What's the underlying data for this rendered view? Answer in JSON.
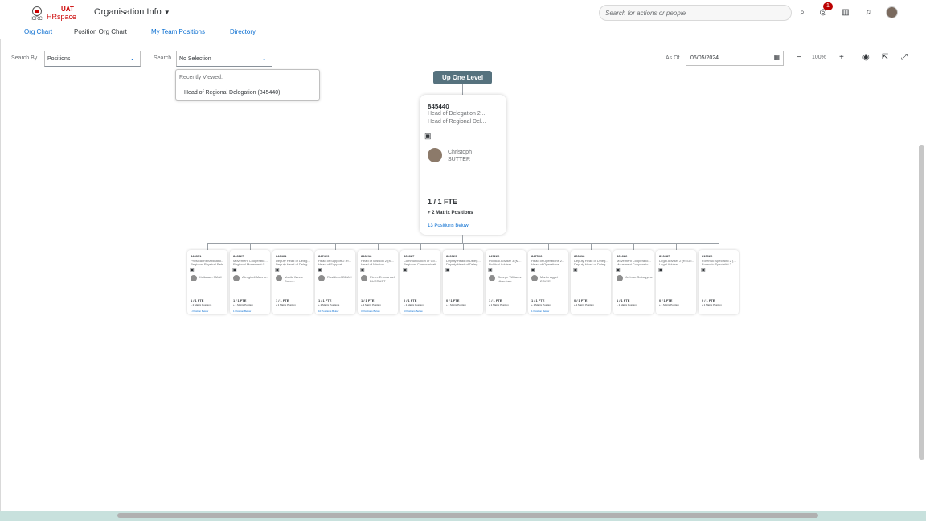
{
  "header": {
    "logo_uat": "UAT",
    "logo_org": "ICRC",
    "logo_product": "HRspace",
    "app_title": "Organisation Info",
    "search_placeholder": "Search for actions or people",
    "notification_count": "1"
  },
  "tabs": [
    {
      "label": "Org Chart"
    },
    {
      "label": "Position Org Chart"
    },
    {
      "label": "My Team Positions"
    },
    {
      "label": "Directory"
    }
  ],
  "toolbar": {
    "search_by_label": "Search By",
    "search_by_value": "Positions",
    "search_label": "Search",
    "search_value": "No Selection",
    "as_of_label": "As Of",
    "as_of_value": "06/05/2024",
    "zoom_level": "100%"
  },
  "dropdown": {
    "header": "Recently Viewed:",
    "item": "Head of Regional Delegation (845440)"
  },
  "chart": {
    "up_one_level": "Up One Level",
    "main": {
      "id": "845440",
      "title1": "Head of Delegation 2 ...",
      "title2": "Head of Regional Del...",
      "name_first": "Christoph",
      "name_last": "SUTTER",
      "fte": "1 / 1 FTE",
      "matrix": "+ 2 Matrix Positions",
      "below": "13 Positions Below"
    },
    "children": [
      {
        "id": "846371",
        "t1": "Physical Rehabilitatio...",
        "t2": "Regional Physical Reh...",
        "name": "Kailasam MANI",
        "fte": "1 / 1 FTE",
        "matrix": "+ 2 Matrix Positions",
        "below": "1 Position Below"
      },
      {
        "id": "846127",
        "t1": "Movement Cooperatio...",
        "t2": "Regional Movement C...",
        "name": "Alengindi Mannu...",
        "fte": "1 / 1 FTE",
        "matrix": "+ 1 Matrix Position",
        "below": "1 Position Below"
      },
      {
        "id": "846461",
        "t1": "Deputy Head of Deleg...",
        "t2": "Deputy Head of Deleg...",
        "name": "Vanile Weele Dono...",
        "fte": "1 / 1 FTE",
        "matrix": "+ 1 Matrix Position",
        "below": ""
      },
      {
        "id": "847429",
        "t1": "Head of Support 2 (R...",
        "t2": "Head of Support",
        "name": "Rusidina ADDAH",
        "fte": "1 / 1 FTE",
        "matrix": "+ 2 Matrix Positions",
        "below": "10 Positions Below"
      },
      {
        "id": "846218",
        "t1": "Head of Mission 2 (M...",
        "t2": "Head of Mission",
        "name": "Pierre Emmanuel DUCRUET",
        "fte": "1 / 1 FTE",
        "matrix": "+ 1 Matrix Position",
        "below": "3 Positions Below"
      },
      {
        "id": "860627",
        "t1": "Communication or Co...",
        "t2": "Regional Communicati...",
        "name": "",
        "fte": "0 / 1 FTE",
        "matrix": "+ 1 Matrix Position",
        "below": "4 Positions Below"
      },
      {
        "id": "860029",
        "t1": "Deputy Head of Deleg...",
        "t2": "Deputy Head of Deleg...",
        "name": "",
        "fte": "0 / 1 FTE",
        "matrix": "+ 1 Matrix Position",
        "below": ""
      },
      {
        "id": "847222",
        "t1": "Political Adviser 3 (M...",
        "t2": "Political Adviser",
        "name": "George Williams Nkambwe",
        "fte": "1 / 1 FTE",
        "matrix": "+ 1 Matrix Position",
        "below": ""
      },
      {
        "id": "847506",
        "t1": "Head of Operations 2...",
        "t2": "Head of Operations",
        "name": "Martin Agyei ZOLVE",
        "fte": "1 / 1 FTE",
        "matrix": "+ 1 Matrix Position",
        "below": "1 Position Below"
      },
      {
        "id": "860818",
        "t1": "Deputy Head of Deleg...",
        "t2": "Deputy Head of Deleg...",
        "name": "",
        "fte": "0 / 1 FTE",
        "matrix": "+ 1 Matrix Position",
        "below": ""
      },
      {
        "id": "861622",
        "t1": "Movement Cooperatio...",
        "t2": "Movement Cooperatio...",
        "name": "Jerbrae Sebugyme",
        "fte": "1 / 1 FTE",
        "matrix": "+ 1 Matrix Position",
        "below": ""
      },
      {
        "id": "810487",
        "t1": "Legal Adviser 2 (REDE...",
        "t2": "Legal Adviser",
        "name": "",
        "fte": "0 / 1 FTE",
        "matrix": "+ 1 Matrix Position",
        "below": ""
      },
      {
        "id": "815922",
        "t1": "Forensic Specialist 2 (...",
        "t2": "Forensic Specialist 2",
        "name": "",
        "fte": "0 / 1 FTE",
        "matrix": "+ 1 Matrix Position",
        "below": ""
      }
    ]
  }
}
